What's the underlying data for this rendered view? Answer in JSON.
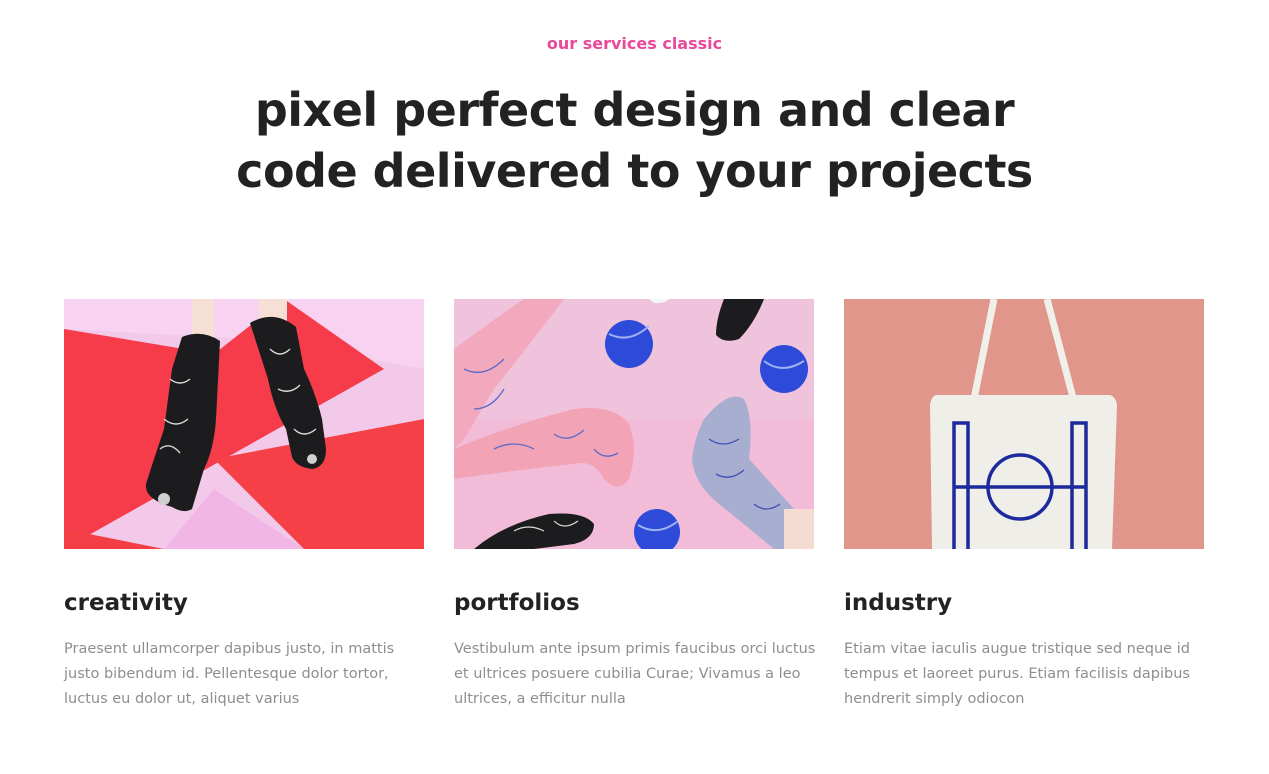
{
  "section": {
    "eyebrow": "our services classic",
    "heading_line1": "pixel perfect design and clear",
    "heading_line2": "code delivered to your projects"
  },
  "cards": [
    {
      "title": "creativity",
      "text": "Praesent ullamcorper dapibus justo, in mattis justo bibendum id. Pellentesque dolor tortor, luctus eu dolor ut, aliquet varius"
    },
    {
      "title": "portfolios",
      "text": "Vestibulum ante ipsum primis faucibus orci luctus et ultrices posuere cubilia Curae; Vivamus a leo ultrices, a efficitur nulla"
    },
    {
      "title": "industry",
      "text": "Etiam vitae iaculis augue tristique sed neque id tempus et laoreet purus. Etiam facilisis dapibus hendrerit simply odiocon"
    }
  ],
  "colors": {
    "accent": "#e8499a",
    "heading": "#222222",
    "body_text": "#8e8e8e"
  }
}
